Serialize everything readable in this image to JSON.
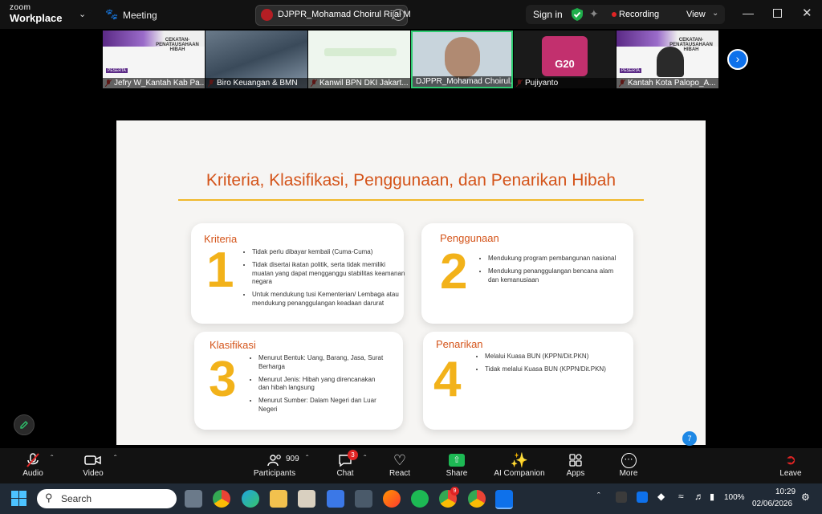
{
  "app": {
    "brand_top": "zoom",
    "brand_bottom": "Workplace",
    "meeting_label": "Meeting",
    "meeting_name": "DJPPR_Mohamad Choirul Rijal M",
    "sign_in": "Sign in",
    "recording": "Recording",
    "view": "View"
  },
  "thumbnails": [
    {
      "name": "Jefry W_Kantah Kab Pa...",
      "slide_title": "CEKATAN-PENATAUSAHAAN HIBAH",
      "tag": "PESERTA"
    },
    {
      "name": "Biro Keuangan & BMN"
    },
    {
      "name": "Kanwil BPN DKI Jakart..."
    },
    {
      "name": "DJPPR_Mohamad Choirul..."
    },
    {
      "name": "Pujiyanto",
      "logo_text": "G20"
    },
    {
      "name": "Kantah Kota Palopo_A...",
      "slide_title": "CEKATAN-PENATAUSAHAAN HIBAH",
      "tag": "PESERTA"
    }
  ],
  "slide": {
    "title": "Kriteria, Klasifikasi, Penggunaan, dan Penarikan Hibah",
    "page": "7",
    "cards": [
      {
        "title": "Kriteria",
        "num": "1",
        "items": [
          "Tidak perlu dibayar kembali (Cuma-Cuma)",
          "Tidak disertai ikatan politik, serta tidak memiliki muatan yang dapat mengganggu stabilitas keamanan negara",
          "Untuk mendukung tusi Kementerian/ Lembaga atau mendukung penanggulangan keadaan darurat"
        ]
      },
      {
        "title": "Penggunaan",
        "num": "2",
        "items": [
          "Mendukung program pembangunan nasional",
          "Mendukung penanggulangan bencana alam dan kemanusiaan"
        ]
      },
      {
        "title": "Klasifikasi",
        "num": "3",
        "items": [
          "Menurut Bentuk: Uang, Barang, Jasa, Surat Berharga",
          "Menurut Jenis: Hibah yang direncanakan dan hibah langsung",
          "Menurut Sumber: Dalam Negeri dan Luar Negeri"
        ]
      },
      {
        "title": "Penarikan",
        "num": "4",
        "items": [
          "Melalui Kuasa BUN (KPPN/Dit.PKN)",
          "Tidak melalui Kuasa BUN (KPPN/Dit.PKN)"
        ]
      }
    ]
  },
  "toolbar": {
    "audio": "Audio",
    "video": "Video",
    "participants": "Participants",
    "participant_count": "909",
    "chat": "Chat",
    "chat_badge": "3",
    "react": "React",
    "share": "Share",
    "ai": "AI Companion",
    "apps": "Apps",
    "more": "More",
    "leave": "Leave"
  },
  "taskbar": {
    "search_placeholder": "Search",
    "battery": "100%",
    "time": "10:29",
    "date": "02/06/2026",
    "badge": "9"
  },
  "colors": {
    "accent_orange": "#d4541a",
    "number_yellow": "#f2b21a",
    "share_green": "#1db954",
    "record_red": "#e02424",
    "shield_green": "#1fae4b"
  }
}
